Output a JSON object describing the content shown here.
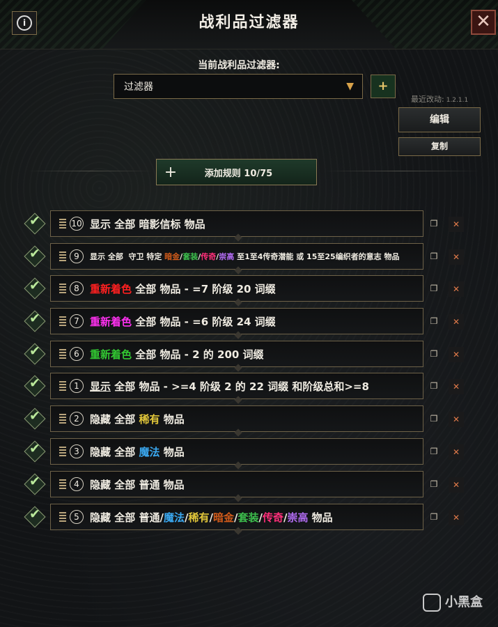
{
  "header": {
    "title": "战利品过滤器",
    "info_glyph": "i",
    "close_glyph": "✕"
  },
  "filter": {
    "current_label": "当前战利品过滤器:",
    "selected": "过滤器",
    "add_glyph": "+",
    "last_modified_label": "最近改动:",
    "version": "1.2.1.1"
  },
  "actions": {
    "edit": "编辑",
    "copy": "复制",
    "add_rule": "添加规则 10/75",
    "add_rule_glyph": "+"
  },
  "colors": {
    "exalted": "#d05a1a",
    "set": "#3cbc4c",
    "unique": "#ff2f7a",
    "legendary": "#b06bf0",
    "rare": "#e2c73a",
    "magic": "#3aa8f0",
    "red": "#ff2020",
    "magenta": "#ff30f0",
    "green": "#32c832"
  },
  "rules": [
    {
      "num": "10",
      "small": false,
      "segments": [
        {
          "t": "显示 全部 暗影信标 物品"
        }
      ]
    },
    {
      "num": "9",
      "small": true,
      "segments": [
        {
          "t": "显示 全部  守卫 特定 "
        },
        {
          "t": "暗金",
          "c": "exalted"
        },
        {
          "t": "/"
        },
        {
          "t": "套装",
          "c": "set"
        },
        {
          "t": "/"
        },
        {
          "t": "传奇",
          "c": "unique"
        },
        {
          "t": "/"
        },
        {
          "t": "崇高",
          "c": "legendary"
        },
        {
          "t": " 至1至4传奇潜能 或 15至25编织者的意志 物品"
        }
      ]
    },
    {
      "num": "8",
      "small": false,
      "segments": [
        {
          "t": "重新着色",
          "c": "red"
        },
        {
          "t": " 全部 物品 - =7 阶级 20 词缀"
        }
      ]
    },
    {
      "num": "7",
      "small": false,
      "segments": [
        {
          "t": "重新着色",
          "c": "magenta"
        },
        {
          "t": " 全部 物品 - =6 阶级 24 词缀"
        }
      ]
    },
    {
      "num": "6",
      "small": false,
      "segments": [
        {
          "t": "重新着色",
          "c": "green"
        },
        {
          "t": " 全部 物品 - 2 的 200 词缀"
        }
      ]
    },
    {
      "num": "1",
      "small": false,
      "segments": [
        {
          "t": "显示",
          "u": true
        },
        {
          "t": " 全部 物品 - >=4 阶级 2 的 22 词缀 和阶级总和>=8"
        }
      ]
    },
    {
      "num": "2",
      "small": false,
      "segments": [
        {
          "t": "隐藏 全部 "
        },
        {
          "t": "稀有",
          "c": "rare"
        },
        {
          "t": " 物品"
        }
      ]
    },
    {
      "num": "3",
      "small": false,
      "segments": [
        {
          "t": "隐藏 全部 "
        },
        {
          "t": "魔法",
          "c": "magic"
        },
        {
          "t": " 物品"
        }
      ]
    },
    {
      "num": "4",
      "small": false,
      "segments": [
        {
          "t": "隐藏 全部 普通 物品"
        }
      ]
    },
    {
      "num": "5",
      "small": false,
      "segments": [
        {
          "t": "隐藏 全部 普通/"
        },
        {
          "t": "魔法",
          "c": "magic"
        },
        {
          "t": "/"
        },
        {
          "t": "稀有",
          "c": "rare"
        },
        {
          "t": "/"
        },
        {
          "t": "暗金",
          "c": "exalted"
        },
        {
          "t": "/"
        },
        {
          "t": "套装",
          "c": "set"
        },
        {
          "t": "/"
        },
        {
          "t": "传奇",
          "c": "unique"
        },
        {
          "t": "/"
        },
        {
          "t": "崇高",
          "c": "legendary"
        },
        {
          "t": " 物品"
        }
      ]
    }
  ],
  "rule_icons": {
    "check": "✔",
    "copy": "❐",
    "delete": "✕"
  },
  "watermark": "小黑盒"
}
